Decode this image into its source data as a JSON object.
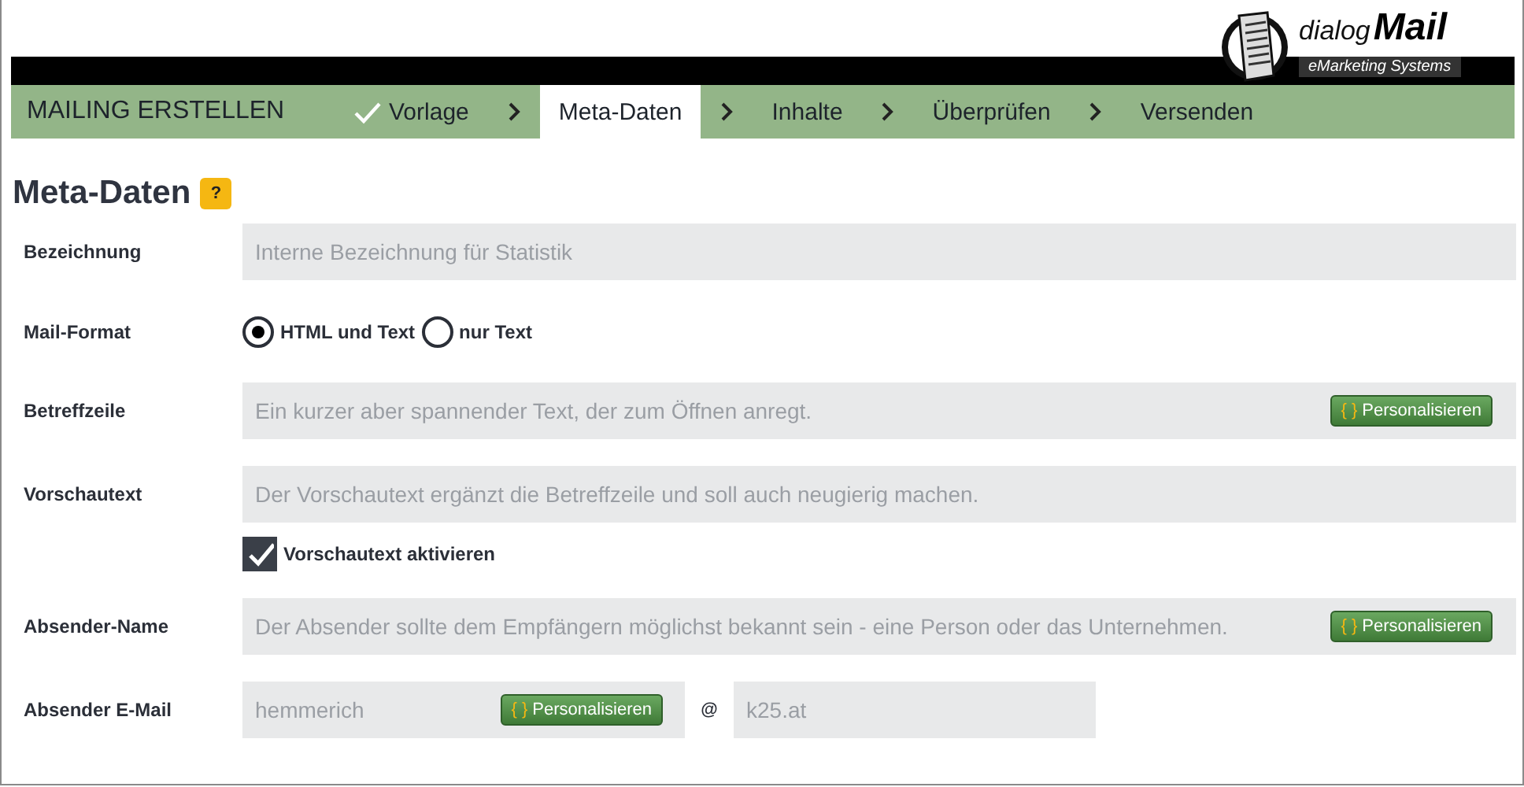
{
  "logo": {
    "word_1": "dialog",
    "word_2": "Mail",
    "tagline": "eMarketing Systems"
  },
  "nav": {
    "title": "MAILING ERSTELLEN",
    "steps": [
      {
        "label": "Vorlage",
        "done": true,
        "selected": false
      },
      {
        "label": "Meta-Daten",
        "done": false,
        "selected": true
      },
      {
        "label": "Inhalte",
        "done": false,
        "selected": false
      },
      {
        "label": "Überprüfen",
        "done": false,
        "selected": false
      },
      {
        "label": "Versenden",
        "done": false,
        "selected": false
      }
    ]
  },
  "section": {
    "title": "Meta-Daten",
    "help": "?"
  },
  "fields": [
    {
      "kind": "text",
      "label": "Bezeichnung",
      "placeholder": "Interne Bezeichnung für Statistik"
    },
    {
      "kind": "radio",
      "label": "Mail-Format",
      "options": [
        {
          "label": "HTML und Text",
          "selected": true
        },
        {
          "label": "nur Text",
          "selected": false
        }
      ]
    },
    {
      "kind": "text",
      "label": "Betreffzeile",
      "placeholder": "Ein kurzer aber spannender Text, der zum Öffnen anregt.",
      "button": {
        "icon": "{ }",
        "label": "Personalisieren"
      }
    },
    {
      "kind": "text",
      "label": "Vorschautext",
      "placeholder": "Der Vorschautext ergänzt die Betreffzeile und soll auch neugierig machen.",
      "checkbox": {
        "label": "Vorschautext aktivieren",
        "checked": true
      }
    },
    {
      "kind": "text",
      "label": "Absender-Name",
      "placeholder": "Der Absender sollte dem Empfängern möglichst bekannt sein - eine Person oder das Unternehmen.",
      "button": {
        "icon": "{ }",
        "label": "Personalisieren"
      }
    },
    {
      "kind": "email",
      "label": "Absender E-Mail",
      "local": {
        "placeholder": "hemmerich",
        "button": {
          "icon": "{ }",
          "label": "Personalisieren"
        }
      },
      "at": "@",
      "domain": {
        "placeholder": "k25.at"
      }
    }
  ]
}
